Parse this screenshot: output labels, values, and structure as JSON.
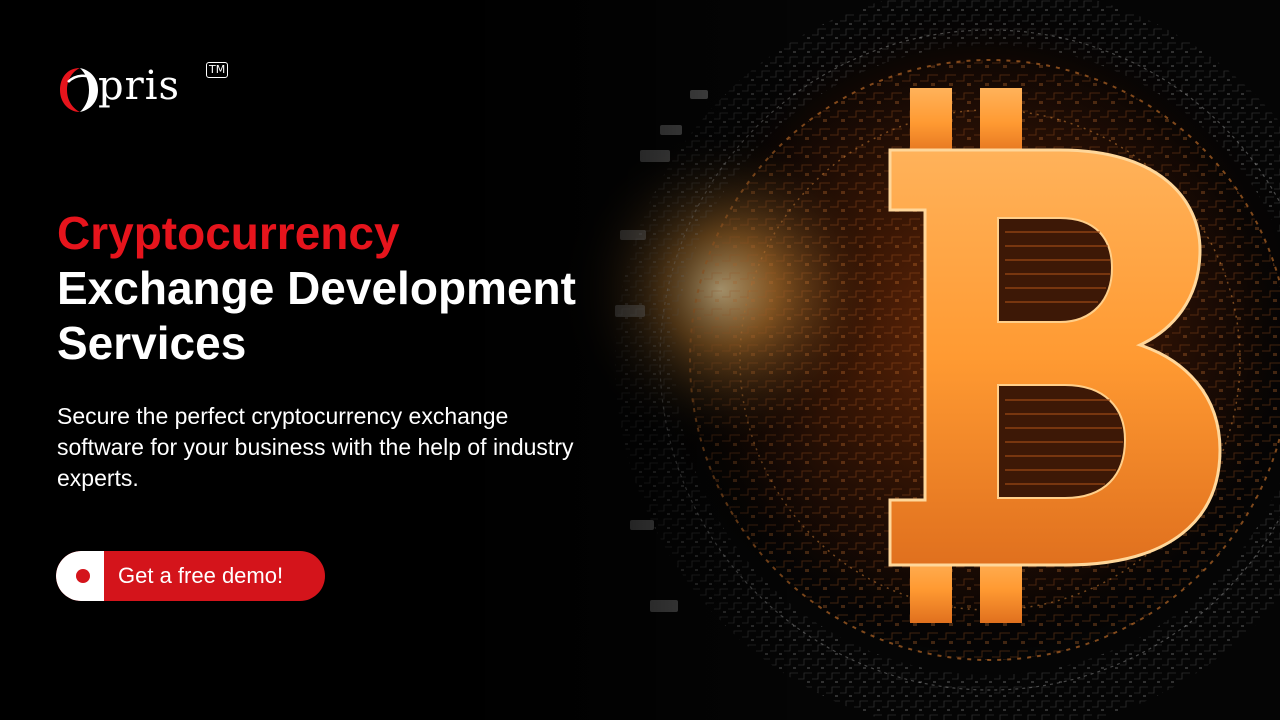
{
  "brand": {
    "name": "pris",
    "trademark": "TM"
  },
  "hero": {
    "headline_accent": "Cryptocurrency",
    "headline_line2": "Exchange Development",
    "headline_line3": "Services",
    "subtitle": "Secure the perfect cryptocurrency exchange software for your business with the help of industry experts."
  },
  "cta": {
    "label": "Get a free demo!"
  },
  "colors": {
    "accent": "#e6141c",
    "button": "#d4141b",
    "background": "#000000",
    "text": "#ffffff",
    "glow": "#f5a23a"
  },
  "icons": {
    "logo_mark": "red-crescent-o",
    "hero_art": "bitcoin-symbol"
  }
}
